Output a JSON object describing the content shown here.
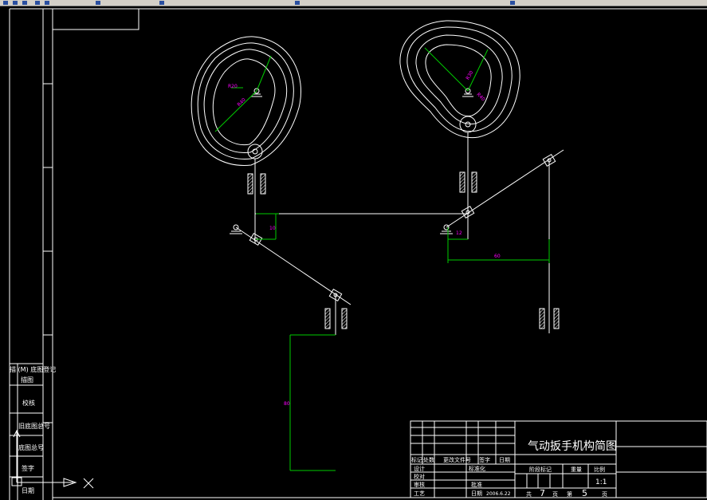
{
  "app": {
    "toolbar": {
      "icons": [
        "open-icon",
        "save-icon",
        "print-icon",
        "undo-icon",
        "redo-icon",
        "pan-icon",
        "zoom-icon",
        "layer-icon",
        "properties-icon"
      ]
    }
  },
  "drawing": {
    "colors": {
      "background": "#000000",
      "lines": "#ffffff",
      "dimensions": "#00cc00",
      "dimension_text": "#ff00ff"
    },
    "dimensions": {
      "cam_left_r1": "R20",
      "cam_left_r2": "R40",
      "cam_right_r1": "R30",
      "cam_right_r2": "R40",
      "left_small": "10",
      "right_small": "12",
      "right_horizontal": "60",
      "left_vertical": "80"
    },
    "left_revision_block": {
      "rows": [
        "描 (M) 底图登记",
        "描图",
        "校核",
        "旧底图总号",
        "底图总号",
        "签字",
        "日期"
      ]
    },
    "title_block": {
      "title": "气动扳手机构简图",
      "header_cells": [
        "标记",
        "处数",
        "更改文件号",
        "签字",
        "日期"
      ],
      "row_labels": [
        "设计",
        "校对",
        "审核",
        "工艺"
      ],
      "standardization": "标准化",
      "approval": "批准",
      "date_label": "日期",
      "date_value": "2006.6.22",
      "stage_label": "阶段标记",
      "weight_label": "重量",
      "scale_label": "比例",
      "scale_value": "1:1",
      "sheets_total_prefix": "共",
      "sheets_total": "7",
      "sheets_unit1": "页",
      "sheet_no_prefix": "第",
      "sheet_no": "5",
      "sheets_unit2": "页"
    }
  }
}
